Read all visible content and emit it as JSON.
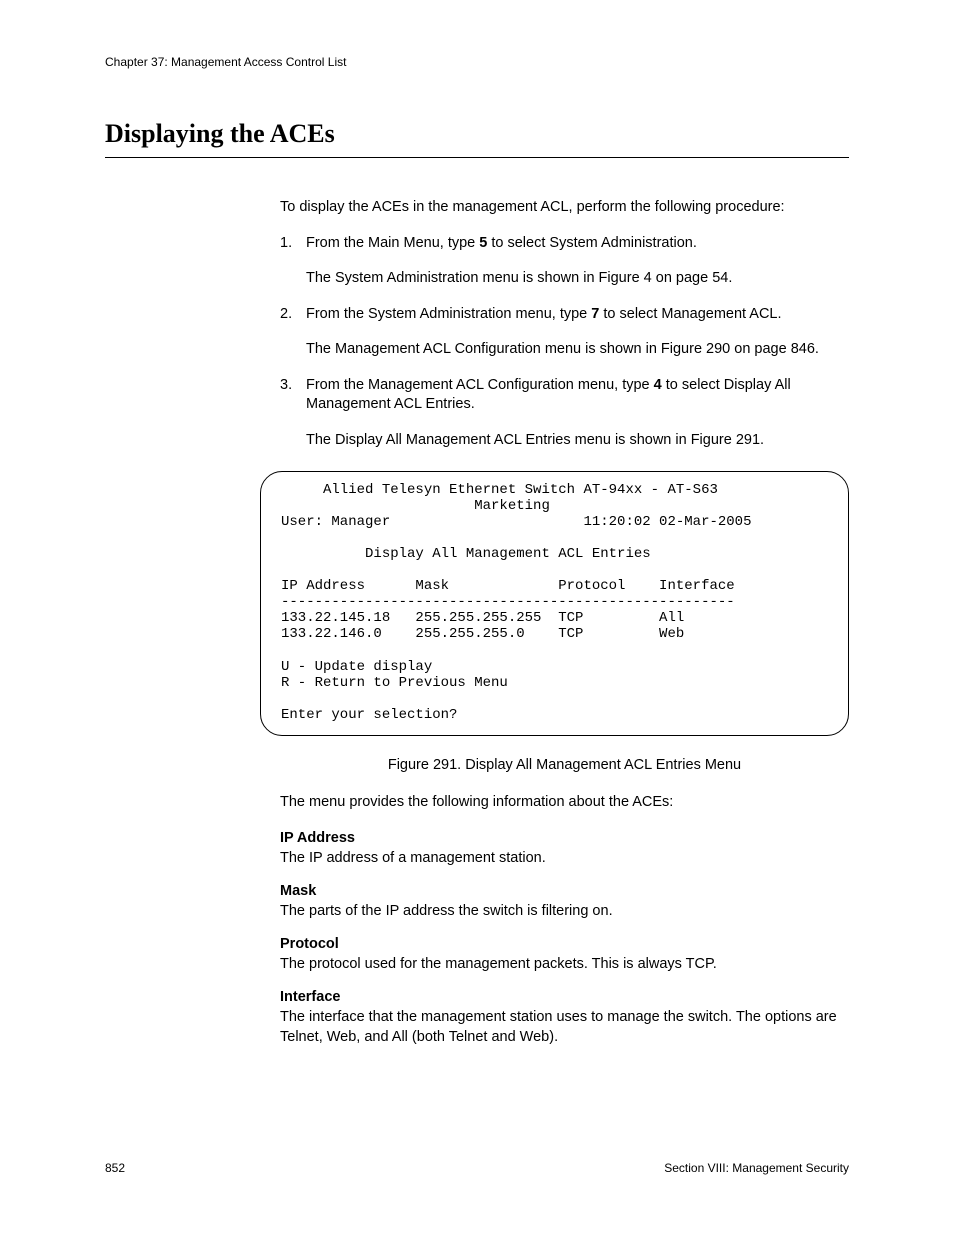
{
  "header": {
    "chapter": "Chapter 37: Management Access Control List"
  },
  "title": "Displaying the ACEs",
  "intro": "To display the ACEs in the management ACL, perform the following procedure:",
  "steps": {
    "s1_a": "From the Main Menu, type ",
    "s1_b": "5",
    "s1_c": " to select System Administration.",
    "s1_sub": "The System Administration menu is shown in Figure 4 on page 54.",
    "s2_a": "From the System Administration menu, type ",
    "s2_b": "7",
    "s2_c": " to select Management ACL.",
    "s2_sub": "The Management ACL Configuration menu is shown in Figure 290 on page 846.",
    "s3_a": "From the Management ACL Configuration menu, type ",
    "s3_b": "4",
    "s3_c": " to select Display All Management ACL Entries.",
    "s3_sub": "The Display All Management ACL Entries menu is shown in Figure 291."
  },
  "terminal": "     Allied Telesyn Ethernet Switch AT-94xx - AT-S63\n                       Marketing\nUser: Manager                       11:20:02 02-Mar-2005\n\n          Display All Management ACL Entries\n\nIP Address      Mask             Protocol    Interface\n------------------------------------------------------\n133.22.145.18   255.255.255.255  TCP         All\n133.22.146.0    255.255.255.0    TCP         Web\n\nU - Update display\nR - Return to Previous Menu\n\nEnter your selection?",
  "figure_caption": "Figure 291. Display All Management ACL Entries Menu",
  "info_intro": "The menu provides the following information about the ACEs:",
  "defs": {
    "ip_t": "IP Address",
    "ip_b": "The IP address of a management station.",
    "mask_t": "Mask",
    "mask_b": "The parts of the IP address the switch is filtering on.",
    "proto_t": "Protocol",
    "proto_b": "The protocol used for the management packets. This is always TCP.",
    "iface_t": "Interface",
    "iface_b": "The interface that the management station uses to manage the switch. The options are Telnet, Web, and All (both Telnet and Web)."
  },
  "footer": {
    "page": "852",
    "section": "Section VIII: Management Security"
  }
}
